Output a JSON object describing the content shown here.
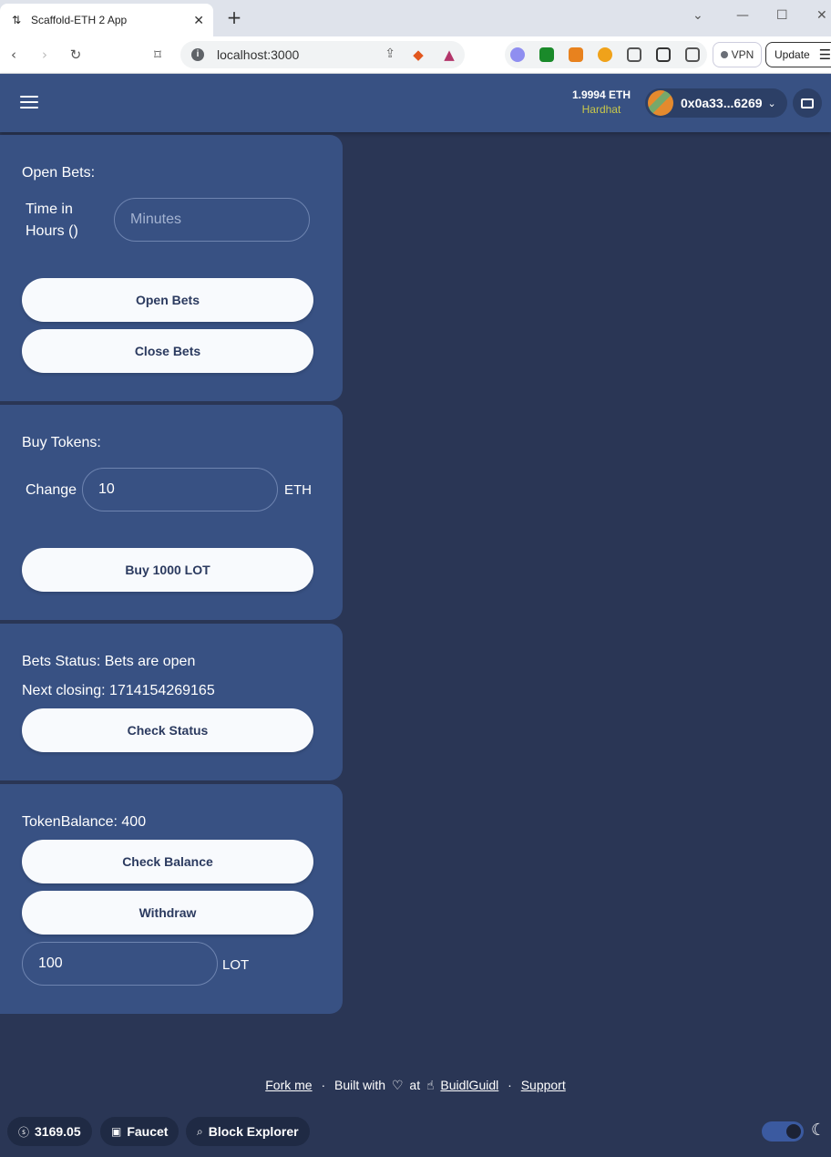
{
  "browser": {
    "tab_title": "Scaffold-ETH 2 App",
    "favicon": "scaffold-icon",
    "url": "localhost:3000",
    "vpn_label": "VPN",
    "update_label": "Update"
  },
  "header": {
    "balance": "1.9994 ETH",
    "network": "Hardhat",
    "address": "0x0a33...6269"
  },
  "open_bets": {
    "title": "Open Bets:",
    "time_label_line1": "Time in",
    "time_label_line2": "Hours ()",
    "minutes_placeholder": "Minutes",
    "open_button": "Open Bets",
    "close_button": "Close Bets"
  },
  "buy_tokens": {
    "title": "Buy Tokens:",
    "change_label": "Change",
    "amount_value": "10",
    "unit": "ETH",
    "buy_button": "Buy 1000 LOT"
  },
  "status": {
    "bets_status": "Bets Status: Bets are open",
    "next_closing": "Next closing: 1714154269165",
    "check_button": "Check Status"
  },
  "balance_card": {
    "token_balance": "TokenBalance: 400",
    "check_button": "Check Balance",
    "withdraw_button": "Withdraw",
    "withdraw_amount": "100",
    "unit": "LOT"
  },
  "footer": {
    "fork_me": "Fork me",
    "sep": "·",
    "built_with": "Built with",
    "at": "at",
    "buidlguidl": "BuidlGuidl",
    "support": "Support",
    "price": "3169.05",
    "faucet": "Faucet",
    "block_explorer": "Block Explorer"
  }
}
